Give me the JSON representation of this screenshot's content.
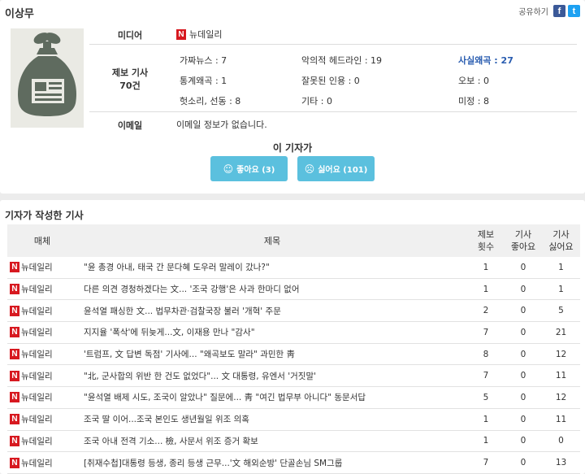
{
  "reporter": {
    "name": "이상무"
  },
  "share": {
    "label": "공유하기",
    "facebook_icon": "f",
    "twitter_icon": "t"
  },
  "info": {
    "media_label": "미디어",
    "media_name": "뉴데일리",
    "media_logo": "N",
    "report_label": "제보 기사",
    "report_count": "70건",
    "email_label": "이메일",
    "email_text": "이메일 정보가 없습니다."
  },
  "stats": [
    {
      "label": "가짜뉴스 : 7"
    },
    {
      "label": "악의적 헤드라인 : 19"
    },
    {
      "label": "사실왜곡 : 27"
    },
    {
      "label": "통계왜곡 : 1"
    },
    {
      "label": "잘못된 인용 : 0"
    },
    {
      "label": "오보 : 0"
    },
    {
      "label": "헛소리, 선동 : 8"
    },
    {
      "label": "기타 : 0"
    },
    {
      "label": "미정 : 8"
    }
  ],
  "vote": {
    "title": "이 기자가",
    "like_label": "좋아요 (3)",
    "dislike_label": "싫어요 (101)"
  },
  "articles": {
    "section_title": "기자가 작성한 기사",
    "headers": {
      "media": "매체",
      "title": "제목",
      "reports": [
        "제보",
        "횟수"
      ],
      "likes": [
        "기사",
        "좋아요"
      ],
      "dislikes": [
        "기사",
        "싫어요"
      ]
    },
    "rows": [
      {
        "media": "뉴데일리",
        "title": "\"윤 총경 아내, 태국 간 문다혜 도우러 말레이 갔나?\"",
        "reports": "1",
        "likes": "0",
        "dislikes": "1"
      },
      {
        "media": "뉴데일리",
        "title": "다른 의견 경청하겠다는 文... '조국 강행'은 사과 한마디 없어",
        "reports": "1",
        "likes": "0",
        "dislikes": "1"
      },
      {
        "media": "뉴데일리",
        "title": "윤석열 패싱한 文... 법무차관·검찰국장 불러 '개혁' 주문",
        "reports": "2",
        "likes": "0",
        "dislikes": "5"
      },
      {
        "media": "뉴데일리",
        "title": "지지율 '폭삭'에 뒤늦게...文, 이재용 만나 \"감사\"",
        "reports": "7",
        "likes": "0",
        "dislikes": "21"
      },
      {
        "media": "뉴데일리",
        "title": "'트럼프, 文 답변 독점' 기사에... \"왜곡보도 말라\" 과민한 靑",
        "reports": "8",
        "likes": "0",
        "dislikes": "12"
      },
      {
        "media": "뉴데일리",
        "title": "\"北, 군사합의 위반 한 건도 없었다\"... 文 대통령, 유엔서 '거짓말'",
        "reports": "7",
        "likes": "0",
        "dislikes": "11"
      },
      {
        "media": "뉴데일리",
        "title": "\"윤석열 배제 시도, 조국이 알았나\" 질문에... 靑 \"여긴 법무부 아니다\" 동문서답",
        "reports": "5",
        "likes": "0",
        "dislikes": "12"
      },
      {
        "media": "뉴데일리",
        "title": "조국 딸 이어...조국 본인도 생년월일 위조 의혹",
        "reports": "1",
        "likes": "0",
        "dislikes": "11"
      },
      {
        "media": "뉴데일리",
        "title": "조국 아내 전격 기소... 檢, 사문서 위조 증거 확보",
        "reports": "1",
        "likes": "0",
        "dislikes": "0"
      },
      {
        "media": "뉴데일리",
        "title": "[취재수첩]대통령 등생, 종리 등생 근무...'文 해외순방' 단골손님 SM그룹",
        "reports": "7",
        "likes": "0",
        "dislikes": "13"
      }
    ]
  }
}
